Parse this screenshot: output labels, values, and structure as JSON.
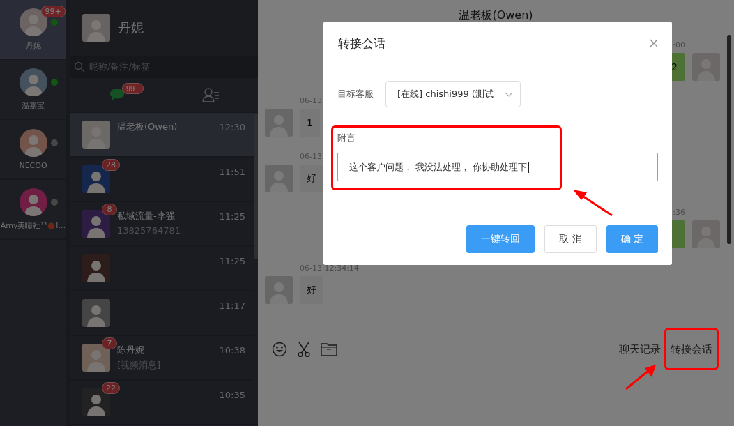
{
  "accounts": [
    {
      "name": "丹妮",
      "online": true,
      "selected": true,
      "badge": "99+"
    },
    {
      "name": "温嘉宝",
      "online": true,
      "selected": false
    },
    {
      "name": "NECOO",
      "online": false,
      "selected": false
    },
    {
      "name": "Amy美瞳社¹³",
      "name_tail": "l…",
      "online": false,
      "selected": false
    }
  ],
  "profile": {
    "name": "丹妮"
  },
  "search": {
    "placeholder": "昵称/备注/标签"
  },
  "tabs": [
    {
      "kind": "chats",
      "selected": true,
      "badge": "99+"
    },
    {
      "kind": "contacts",
      "selected": false
    }
  ],
  "conversations": [
    {
      "name": "温老板(Owen)",
      "time": "12:30",
      "selected": true
    },
    {
      "time": "11:51",
      "badge": "28",
      "selected": false
    },
    {
      "name": "私域流量-李强",
      "time": "11:25",
      "preview": "13825764781",
      "badge": "8",
      "selected": false
    },
    {
      "time": "11:25",
      "selected": false
    },
    {
      "time": "11:17",
      "selected": false
    },
    {
      "name": "陈丹妮",
      "time": "10:38",
      "preview": "[视频消息]",
      "badge": "7",
      "selected": false
    },
    {
      "time": "10:35",
      "badge": "22",
      "selected": false
    }
  ],
  "chat": {
    "title": "温老板(Owen)",
    "messages": [
      {
        "kind": "outgoing",
        "time": ":00",
        "text": "2"
      },
      {
        "kind": "incoming",
        "time": "06-13",
        "text": "1"
      },
      {
        "kind": "incoming",
        "time": "06-13",
        "text": "好"
      },
      {
        "kind": "outgoing",
        "time": ":36"
      },
      {
        "kind": "incoming",
        "time": "06-13 12:34:14",
        "text": "好"
      }
    ],
    "tools": [
      "聊天记录",
      "转接会话"
    ]
  },
  "dialog": {
    "title": "转接会话",
    "target_label": "目标客服",
    "target_value": "[在线] chishi999 (测试",
    "note_label": "附言",
    "note_value": "这个客户问题， 我没法处理， 你协助处理下",
    "buttons": [
      {
        "label": "一键转回",
        "kind": "primary"
      },
      {
        "label": "取 消",
        "kind": "default"
      },
      {
        "label": "确 定",
        "kind": "primary"
      }
    ]
  }
}
